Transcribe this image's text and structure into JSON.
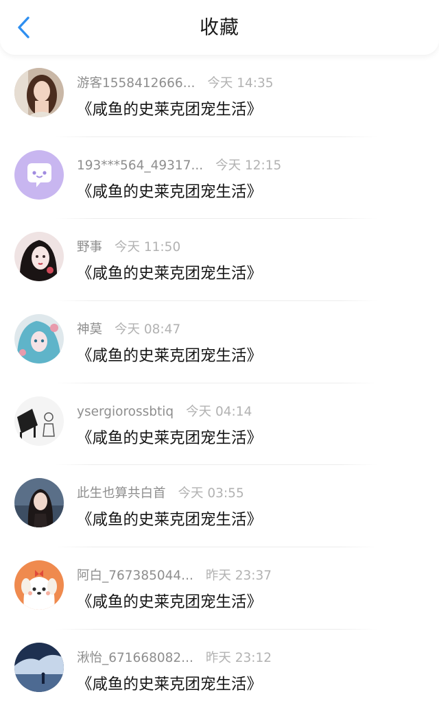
{
  "header": {
    "title": "收藏",
    "back_icon": "chevron-left-icon",
    "accent_color": "#2f8ff0"
  },
  "items": [
    {
      "name": "游客1558412666...",
      "time": "今天 14:35",
      "title": "《咸鱼的史莱克团宠生活》",
      "avatar_icon": "user-photo-avatar"
    },
    {
      "name": "193***564_49317...",
      "time": "今天 12:15",
      "title": "《咸鱼的史莱克团宠生活》",
      "avatar_icon": "chat-bubble-avatar"
    },
    {
      "name": "野事",
      "time": "今天 11:50",
      "title": "《咸鱼的史莱克团宠生活》",
      "avatar_icon": "illustration-avatar"
    },
    {
      "name": "神莫",
      "time": "今天 08:47",
      "title": "《咸鱼的史莱克团宠生活》",
      "avatar_icon": "anime-avatar"
    },
    {
      "name": "ysergiorossbtiq",
      "time": "今天 04:14",
      "title": "《咸鱼的史莱克团宠生活》",
      "avatar_icon": "piano-sketch-avatar"
    },
    {
      "name": "此生也算共白首",
      "time": "今天 03:55",
      "title": "《咸鱼的史莱克团宠生活》",
      "avatar_icon": "user-photo-avatar"
    },
    {
      "name": "阿白_767385044...",
      "time": "昨天 23:37",
      "title": "《咸鱼的史莱克团宠生活》",
      "avatar_icon": "cartoon-dog-avatar"
    },
    {
      "name": "湫怡_671668082...",
      "time": "昨天 23:12",
      "title": "《咸鱼的史莱克团宠生活》",
      "avatar_icon": "night-scene-avatar"
    }
  ]
}
